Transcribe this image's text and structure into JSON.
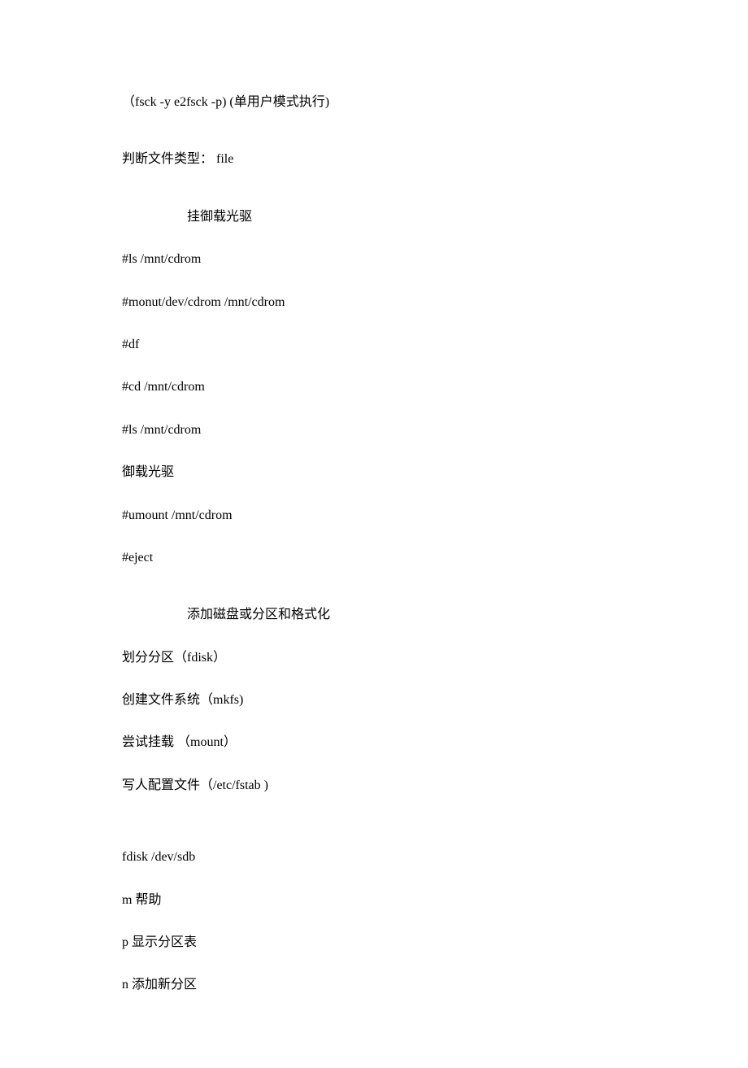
{
  "lines": {
    "l1": "（fsck -y       e2fsck -p) (单用户模式执行)",
    "l2": "判断文件类型：   file",
    "s1": "挂御载光驱",
    "l3": "#ls /mnt/cdrom",
    "l4": "#monut/dev/cdrom /mnt/cdrom",
    "l5": "#df",
    "l6": "#cd /mnt/cdrom",
    "l7": "#ls /mnt/cdrom",
    "l8": "御载光驱",
    "l9": "#umount /mnt/cdrom",
    "l10": "#eject",
    "s2": "添加磁盘或分区和格式化",
    "l11": "划分分区（fdisk）",
    "l12": "创建文件系统（mkfs)",
    "l13": "尝试挂载 （mount）",
    "l14": "写人配置文件（/etc/fstab )",
    "l15": "fdisk /dev/sdb",
    "l16": "m  帮助",
    "l17": "p 显示分区表",
    "l18": "n  添加新分区"
  }
}
